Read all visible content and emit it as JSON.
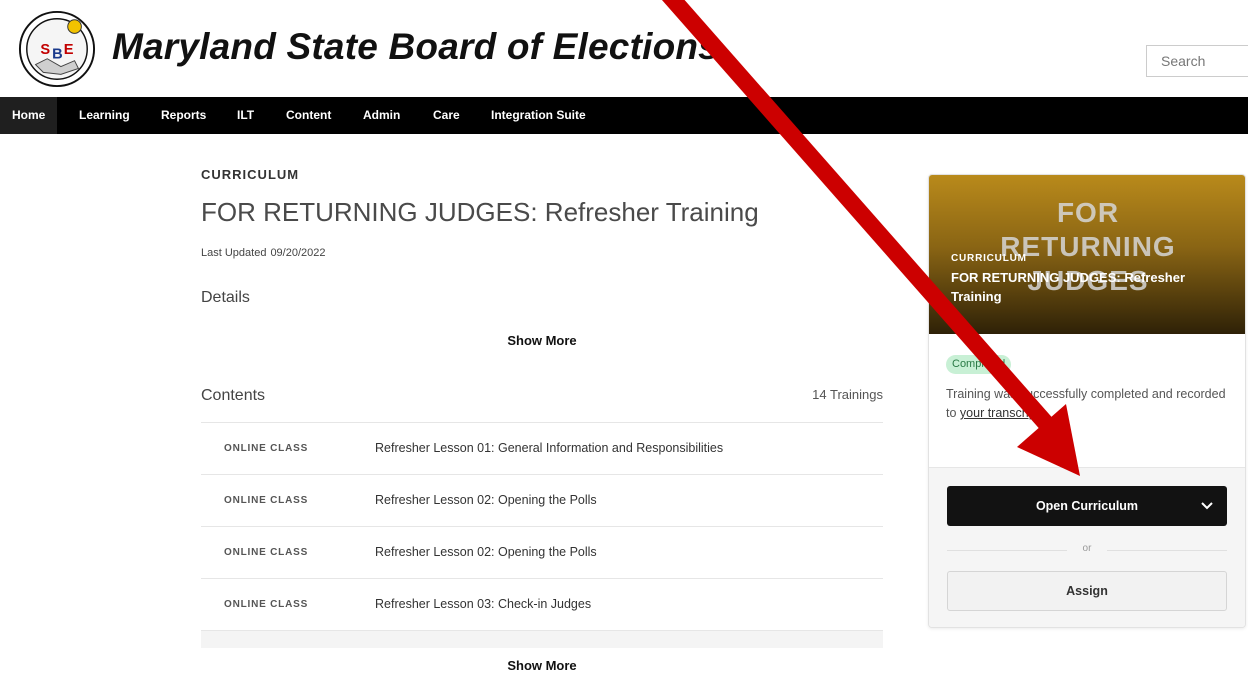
{
  "header": {
    "site_title": "Maryland State Board of Elections",
    "logo_text": "SBE",
    "search_placeholder": "Search"
  },
  "nav": {
    "items": [
      {
        "label": "Home",
        "active": true
      },
      {
        "label": "Learning"
      },
      {
        "label": "Reports"
      },
      {
        "label": "ILT"
      },
      {
        "label": "Content"
      },
      {
        "label": "Admin"
      },
      {
        "label": "Care"
      },
      {
        "label": "Integration Suite"
      }
    ]
  },
  "main": {
    "kicker": "CURRICULUM",
    "title": "FOR RETURNING JUDGES: Refresher Training",
    "updated_label": "Last Updated",
    "updated_date": "09/20/2022",
    "details_heading": "Details",
    "show_more_label": "Show More",
    "contents_heading": "Contents",
    "contents_count": "14 Trainings",
    "contents": [
      {
        "type": "ONLINE CLASS",
        "name": "Refresher Lesson 01: General Information and Responsibilities"
      },
      {
        "type": "ONLINE CLASS",
        "name": "Refresher Lesson 02: Opening the Polls"
      },
      {
        "type": "ONLINE CLASS",
        "name": "Refresher Lesson 02: Opening the Polls"
      },
      {
        "type": "ONLINE CLASS",
        "name": "Refresher Lesson 03: Check-in Judges"
      }
    ],
    "show_more_bottom_label": "Show More"
  },
  "card": {
    "thumbnail_lines": [
      "FOR",
      "RETURNING",
      "JUDGES"
    ],
    "kicker": "CURRICULUM",
    "title": "FOR RETURNING JUDGES: Refresher Training",
    "status_badge": "Completed",
    "status_text": "Training was successfully completed and recorded to",
    "status_link": "your transcript.",
    "open_button_label": "Open Curriculum",
    "or_label": "or",
    "assign_button_label": "Assign"
  },
  "colors": {
    "nav_bg": "#000000",
    "badge_bg": "#c8f0d5",
    "annotation_arrow": "#cc0000"
  }
}
